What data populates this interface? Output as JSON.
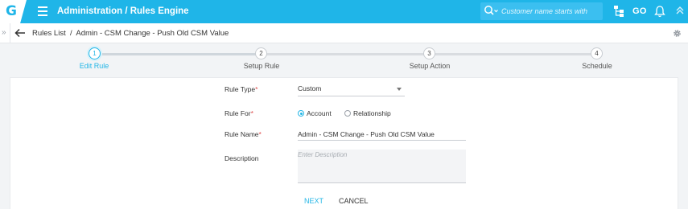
{
  "header": {
    "logo": "G",
    "title": "Administration / Rules Engine",
    "search_placeholder": "Customer name starts with",
    "go_label": "GO",
    "accent": "#1fb5e8"
  },
  "breadcrumb": {
    "text": "Rules List  /  Admin - CSM Change - Push Old CSM Value"
  },
  "stepper": {
    "steps": [
      {
        "number": "1",
        "label": "Edit Rule",
        "active": true
      },
      {
        "number": "2",
        "label": "Setup Rule",
        "active": false
      },
      {
        "number": "3",
        "label": "Setup Action",
        "active": false
      },
      {
        "number": "4",
        "label": "Schedule",
        "active": false
      }
    ]
  },
  "form": {
    "rule_type": {
      "label": "Rule Type",
      "value": "Custom"
    },
    "rule_for": {
      "label": "Rule For",
      "options": [
        "Account",
        "Relationship"
      ],
      "selected": "Account"
    },
    "rule_name": {
      "label": "Rule Name",
      "value": "Admin - CSM Change - Push Old CSM Value"
    },
    "description": {
      "label": "Description",
      "placeholder": "Enter Description"
    },
    "required_mark": "*"
  },
  "buttons": {
    "next": "NEXT",
    "cancel": "CANCEL"
  }
}
